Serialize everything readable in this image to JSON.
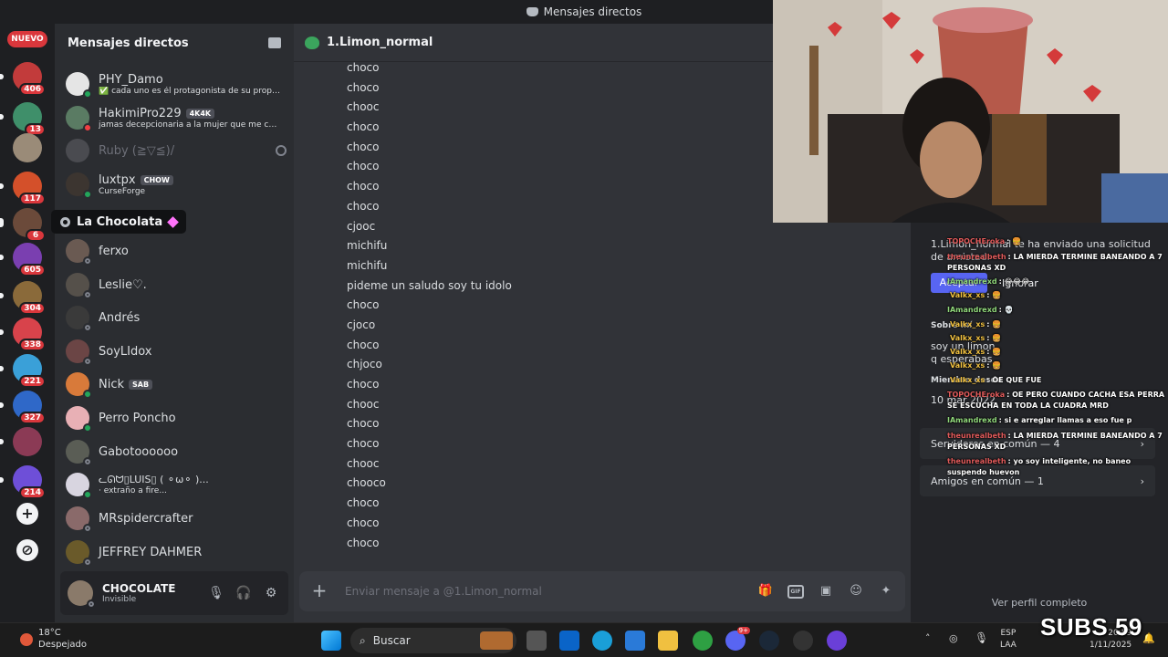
{
  "window": {
    "title": "Mensajes directos"
  },
  "rail": {
    "new_badge": "NUEVO",
    "badges": [
      "406",
      "13",
      "117",
      "6",
      "605",
      "304",
      "338",
      "221",
      "327",
      "214"
    ]
  },
  "tooltip": {
    "server_name": "La Chocolata"
  },
  "dm_sidebar": {
    "title": "Mensajes directos",
    "items": [
      {
        "name": "PHY_Damo",
        "sub": "✅ cada uno es él protagonista de su propi..."
      },
      {
        "name": "HakimiPro229",
        "tag": "4K4K",
        "sub": "jamas decepcionaria a la mujer que me cui..."
      },
      {
        "name": "Ruby (≧▽≦)/"
      },
      {
        "name": "luxtpx",
        "tag": "CHOW",
        "sub": "CurseForge"
      },
      {
        "name": "ferxo"
      },
      {
        "name": "Leslie♡."
      },
      {
        "name": "Andrés"
      },
      {
        "name": "SoyLIdox"
      },
      {
        "name": "Nick",
        "tag": "SAB"
      },
      {
        "name": "Perro Poncho"
      },
      {
        "name": "Gabotoooooo"
      },
      {
        "name": "ᓚᘏᗢ▯LUIS▯ ( ⚬ω⚬ )...",
        "sub": "· extraño a fire..."
      },
      {
        "name": "MRspidercrafter"
      },
      {
        "name": "JEFFREY DAHMER"
      }
    ]
  },
  "user_panel": {
    "name": "CHOCOLATE",
    "status": "Invisible"
  },
  "chat": {
    "channel": "1.Limon_normal",
    "messages": [
      "choco",
      "choco",
      "chooc",
      "choco",
      "choco",
      "choco",
      "choco",
      "choco",
      "cjooc",
      "michifu",
      "michifu",
      "pideme un saludo soy tu idolo",
      "choco",
      "cjoco",
      "choco",
      "chjoco",
      "choco",
      "chooc",
      "choco",
      "choco",
      "chooc",
      "chooco",
      "choco",
      "choco",
      "choco"
    ],
    "placeholder": "Enviar mensaje a @1.Limon_normal"
  },
  "profile": {
    "friend_request": "1.Limon_normal te ha enviado una solicitud de amistad.",
    "accept": "Aceptar",
    "ignore": "Ignorar",
    "about_heading": "Sobre mí",
    "about_line1": "soy un limon",
    "about_line2": "q esperabas",
    "member_since_heading": "Miembro desde",
    "member_since": "10 mar 2022",
    "mutual_servers": "Servidores en común — 4",
    "mutual_friends": "Amigos en común — 1",
    "full_profile": "Ver perfil completo"
  },
  "stream_chat": [
    {
      "user": "TOPOCHEroka",
      "text": ": 🍔"
    },
    {
      "user": "theunrealbeth",
      "text": ": LA MIERDA TERMINE BANEANDO A 7 PERSONAS XD"
    },
    {
      "user": "IAmandrexd",
      "text": ": 😂😂😂"
    },
    {
      "user": "Valkx_xs",
      "text": ": 🍔"
    },
    {
      "user": "IAmandrexd",
      "text": ": 💀"
    },
    {
      "user": "Valkx_xs",
      "text": ": 🍔"
    },
    {
      "user": "Valkx_xs",
      "text": ": 🍔"
    },
    {
      "user": "Valkx_xs",
      "text": ": 🍔"
    },
    {
      "user": "Valkx_xs",
      "text": ": 🍔"
    },
    {
      "user": "Valkx_xs",
      "text": ": OE QUE FUE"
    },
    {
      "user": "TOPOCHEroka",
      "text": ": OE PERO CUANDO CACHA ESA PERRA SE ESCUCHA EN TODA LA CUADRA MRD"
    },
    {
      "user": "IAmandrexd",
      "text": ": si e arreglar llamas a eso fue p"
    },
    {
      "user": "theunrealbeth",
      "text": ": LA MIERDA TERMINE BANEANDO A 7 PERSONAS XD"
    },
    {
      "user": "theunrealbeth",
      "text": ": yo soy inteligente, no baneo suspendo huevon"
    }
  ],
  "taskbar": {
    "temp": "18°C",
    "weather": "Despejado",
    "search": "Buscar",
    "lang1": "ESP",
    "lang2": "LAA",
    "time": "20:59",
    "date": "1/11/2025",
    "discord_badge": "9+"
  },
  "subs_overlay": "SUBS 59"
}
